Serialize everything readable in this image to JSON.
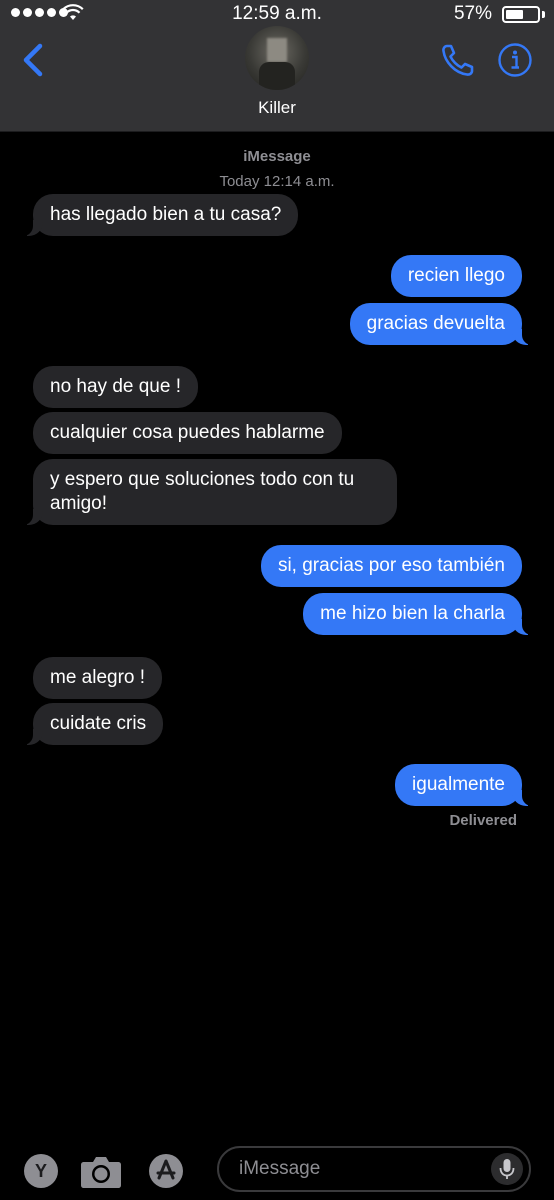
{
  "status_bar": {
    "time": "12:59 a.m.",
    "battery_percent": "57%",
    "battery_level": 0.57,
    "signal_bars": 5
  },
  "header": {
    "contact_name": "Killer",
    "icons": {
      "back": "chevron-left-icon",
      "call": "phone-icon",
      "info": "info-icon"
    }
  },
  "thread": {
    "service": "iMessage",
    "timestamp": "Today 12:14 a.m.",
    "messages": [
      {
        "dir": "in",
        "text": "has llegado bien a tu casa?"
      },
      {
        "dir": "out",
        "text": "recien llego"
      },
      {
        "dir": "out",
        "text": "gracias devuelta"
      },
      {
        "dir": "in",
        "text": "no hay de que !"
      },
      {
        "dir": "in",
        "text": "cualquier cosa puedes hablarme"
      },
      {
        "dir": "in",
        "text": "y espero que soluciones todo con tu amigo!"
      },
      {
        "dir": "out",
        "text": "si, gracias por eso también"
      },
      {
        "dir": "out",
        "text": "me hizo bien la charla"
      },
      {
        "dir": "in",
        "text": "me alegro !"
      },
      {
        "dir": "in",
        "text": "cuidate cris"
      },
      {
        "dir": "out",
        "text": "igualmente"
      }
    ],
    "delivered": "Delivered"
  },
  "input_bar": {
    "yelp_label": "Y",
    "placeholder": "iMessage",
    "colors": {
      "accent": "#3478f6",
      "incoming": "#262629"
    }
  }
}
